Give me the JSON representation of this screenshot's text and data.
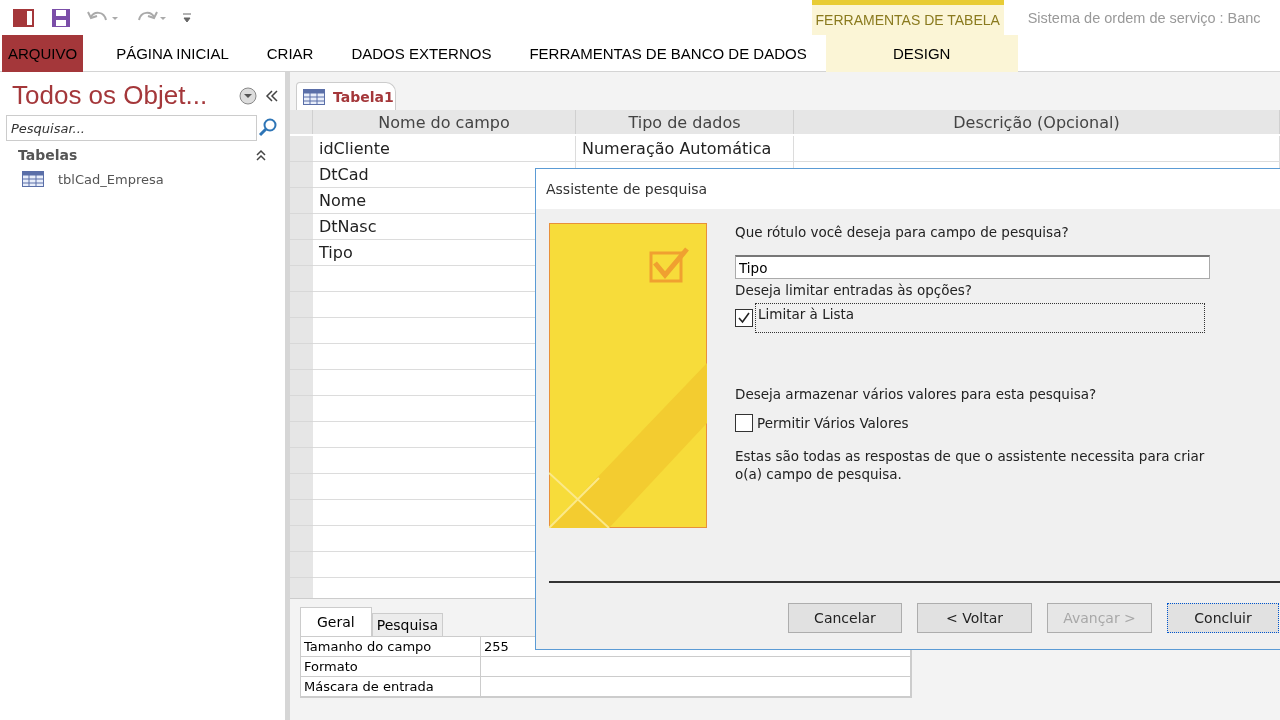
{
  "ribbon": {
    "title": "Sistema de ordem de serviço : Banc",
    "context_group": "FERRAMENTAS DE TABELA",
    "tabs": [
      {
        "label": "ARQUIVO",
        "selected": false,
        "kind": "file"
      },
      {
        "label": "PÁGINA INICIAL",
        "selected": false,
        "kind": "normal"
      },
      {
        "label": "CRIAR",
        "selected": false,
        "kind": "normal"
      },
      {
        "label": "DADOS EXTERNOS",
        "selected": false,
        "kind": "normal"
      },
      {
        "label": "FERRAMENTAS DE BANCO DE DADOS",
        "selected": false,
        "kind": "normal"
      },
      {
        "label": "DESIGN",
        "selected": false,
        "kind": "context"
      }
    ]
  },
  "navigation": {
    "title": "Todos os Objet...",
    "search": {
      "placeholder": "Pesquisar..."
    },
    "group": "Tabelas",
    "items": [
      {
        "label": "tblCad_Empresa"
      }
    ]
  },
  "document_tab": {
    "label": "Tabela1",
    "selected": true
  },
  "design_grid": {
    "columns": [
      "Nome do campo",
      "Tipo de dados",
      "Descrição (Opcional)"
    ],
    "rows": [
      {
        "name": "idCliente",
        "type": "Numeração Automática"
      },
      {
        "name": "DtCad"
      },
      {
        "name": "Nome"
      },
      {
        "name": "DtNasc"
      },
      {
        "name": "Tipo"
      }
    ]
  },
  "properties": {
    "tabs": [
      {
        "label": "Geral",
        "selected": true
      },
      {
        "label": "Pesquisa",
        "selected": false
      }
    ],
    "rows": [
      {
        "label": "Tamanho do campo",
        "value": "255"
      },
      {
        "label": "Formato"
      },
      {
        "label": "Máscara de entrada"
      }
    ]
  },
  "dialog": {
    "title": "Assistente de pesquisa",
    "label_question": "Que rótulo você deseja para campo de pesquisa?",
    "label_value": "Tipo",
    "limit_question": "Deseja limitar entradas às opções?",
    "limit_option": {
      "label": "Limitar à Lista",
      "checked": true
    },
    "multi_question": "Deseja armazenar vários valores para esta pesquisa?",
    "multi_option": {
      "label": "Permitir Vários Valores",
      "checked": false
    },
    "info": "Estas são todas as respostas de que o assistente necessita para criar o(a) campo de pesquisa.",
    "buttons": [
      {
        "label": "Cancelar",
        "disabled": false,
        "focused": false
      },
      {
        "label": "< Voltar",
        "disabled": false,
        "focused": false
      },
      {
        "label": "Avançar >",
        "disabled": true,
        "focused": false
      },
      {
        "label": "Concluir",
        "disabled": false,
        "focused": true
      }
    ]
  }
}
